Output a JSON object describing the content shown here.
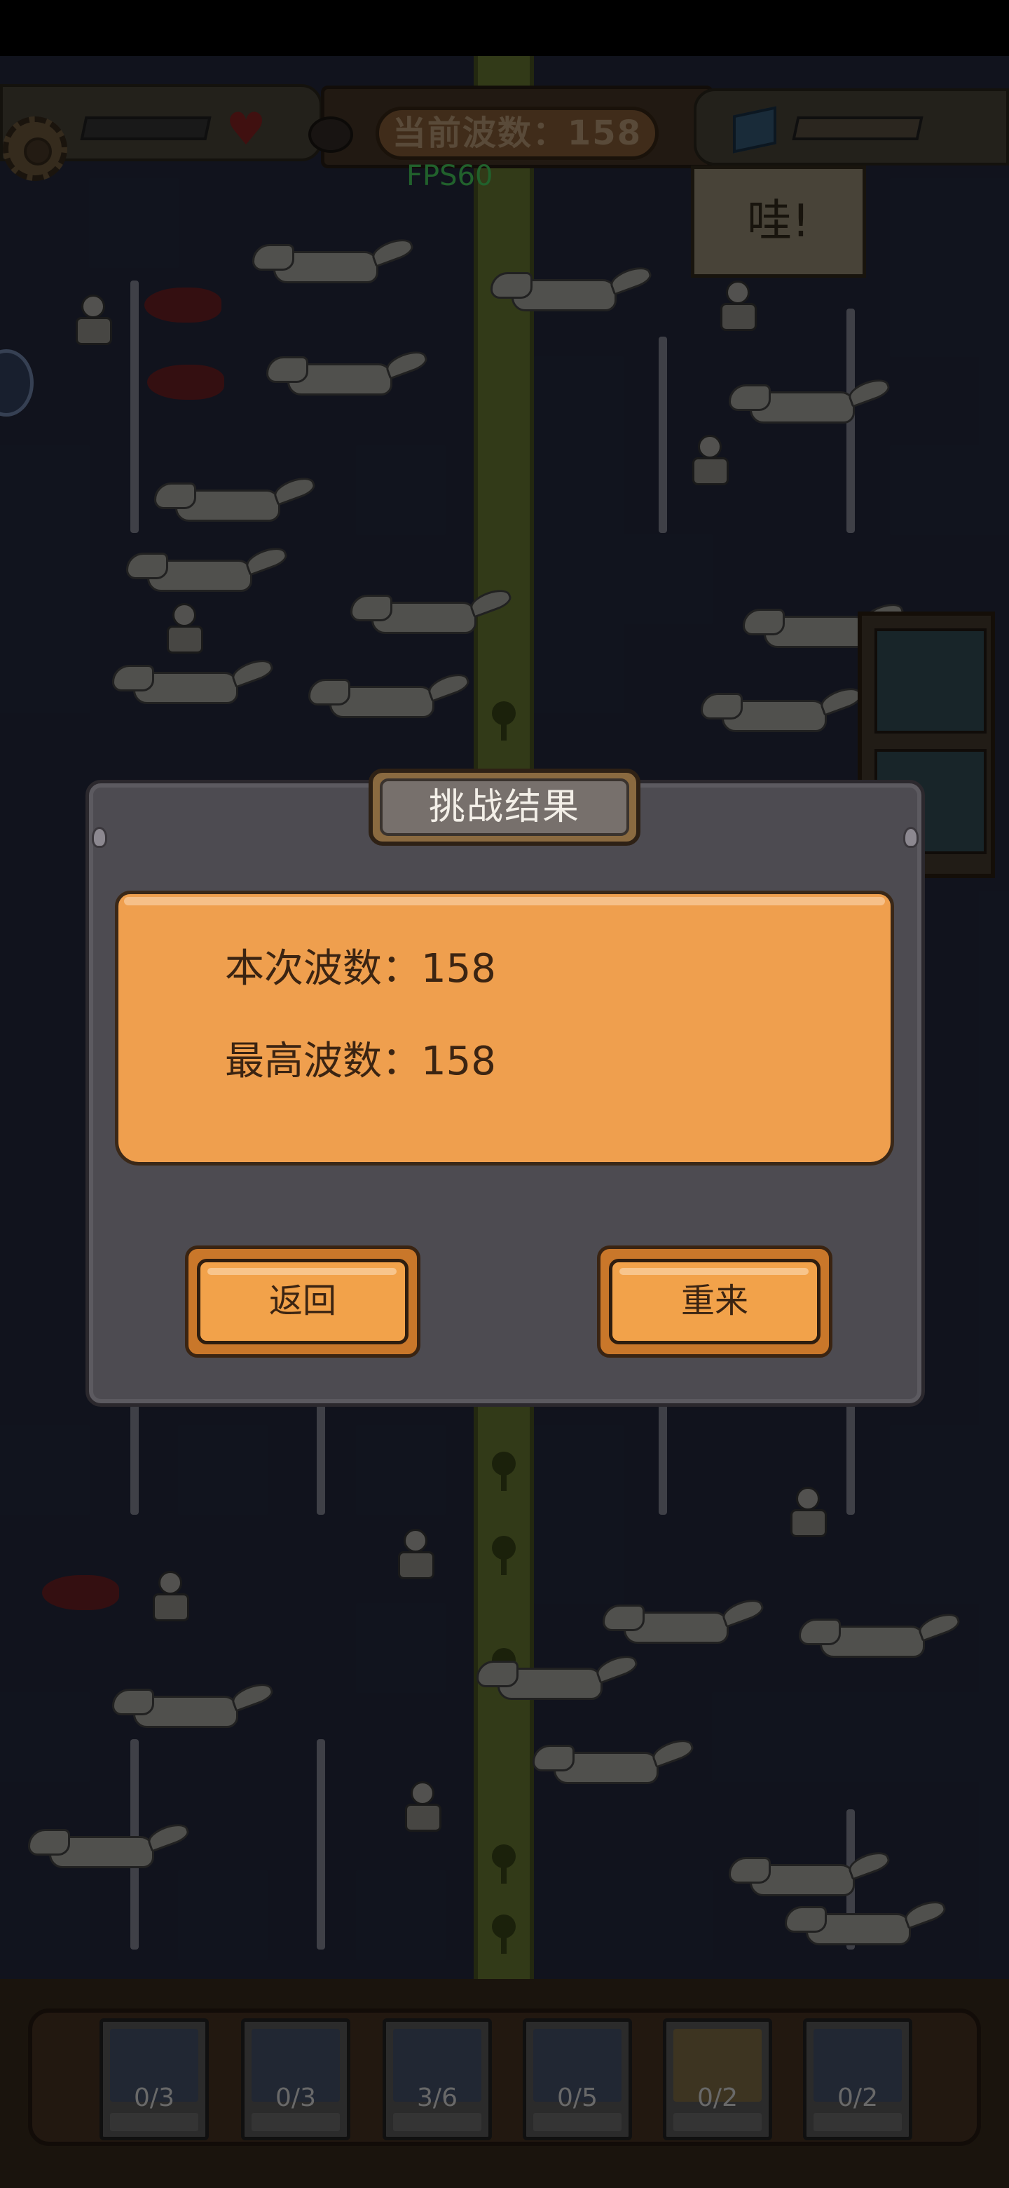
{
  "hud": {
    "wave_label": "当前波数：158",
    "fps": "FPS60",
    "shout": "哇!"
  },
  "dialog": {
    "title": "挑战结果",
    "current_wave": "本次波数：158",
    "best_wave": "最高波数：158",
    "back_label": "返回",
    "retry_label": "重来"
  },
  "units": [
    {
      "count": "0/3"
    },
    {
      "count": "0/3"
    },
    {
      "count": "3/6"
    },
    {
      "count": "0/5"
    },
    {
      "count": "0/2"
    },
    {
      "count": "0/2"
    }
  ]
}
